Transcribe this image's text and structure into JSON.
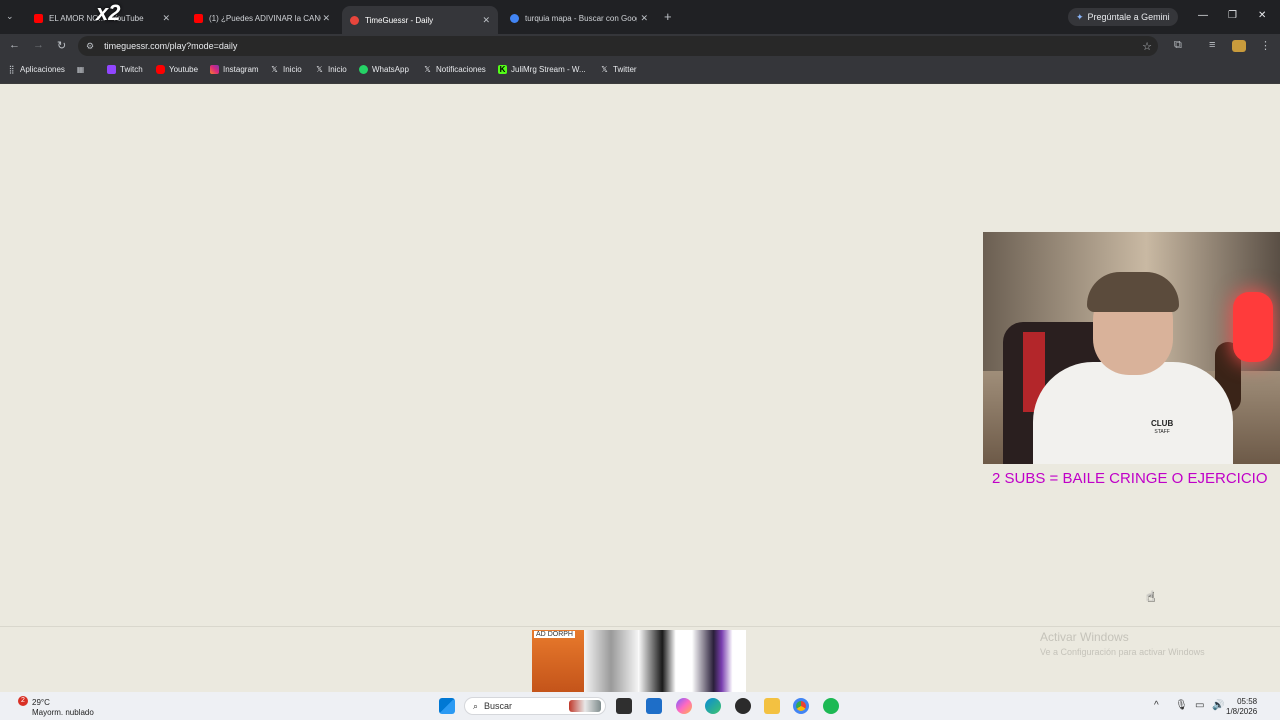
{
  "tabs": [
    {
      "title": "EL AMOR NO... - YouTube",
      "active": false,
      "favicon_color": "#ff0000"
    },
    {
      "title": "(1) ¿Puedes ADIVINAR la CANCIÓN",
      "active": false,
      "favicon_color": "#ff0000"
    },
    {
      "title": "TimeGuessr - Daily",
      "active": true,
      "favicon_color": "#e8453c"
    },
    {
      "title": "turquia mapa - Buscar con Google",
      "active": false,
      "favicon_color": "#4285f4"
    }
  ],
  "overlay_badge": "x2",
  "gemini_label": "Pregúntale a Gemini",
  "url": "timeguessr.com/play?mode=daily",
  "bookmarks": [
    {
      "label": "Aplicaciones",
      "icon": "apps-grid-icon"
    },
    {
      "label": "",
      "icon": "grid-icon"
    },
    {
      "label": "Twitch",
      "icon": "twitch-icon"
    },
    {
      "label": "Youtube",
      "icon": "youtube-icon"
    },
    {
      "label": "Instagram",
      "icon": "instagram-icon"
    },
    {
      "label": "Inicio",
      "icon": "x-icon"
    },
    {
      "label": "Inicio",
      "icon": "x-icon"
    },
    {
      "label": "WhatsApp",
      "icon": "whatsapp-icon"
    },
    {
      "label": "Notificaciones",
      "icon": "x-icon"
    },
    {
      "label": "JuliMrg Stream - W...",
      "icon": "kick-icon"
    },
    {
      "label": "Twitter",
      "icon": "x-icon"
    }
  ],
  "webcam": {
    "shirt_text_line1": "CLUB",
    "shirt_text_line2": "STAFF"
  },
  "sub_goal": "2 SUBS = BAILE CRINGE O EJERCICIO",
  "ad": {
    "label": "AD",
    "brand": "DORPH"
  },
  "activate_windows": {
    "title": "Activar Windows",
    "subtitle": "Ve a Configuración para activar Windows"
  },
  "taskbar": {
    "weather_temp": "29°C",
    "weather_desc": "Mayorm. nublado",
    "weather_badge": "2",
    "search_placeholder": "Buscar",
    "time": "05:58",
    "date": "1/8/2026"
  },
  "colors": {
    "page_bg": "#ebe9df",
    "sub_goal_text": "#c000c8",
    "chrome_dark": "#202124",
    "chrome_toolbar": "#35363a"
  }
}
